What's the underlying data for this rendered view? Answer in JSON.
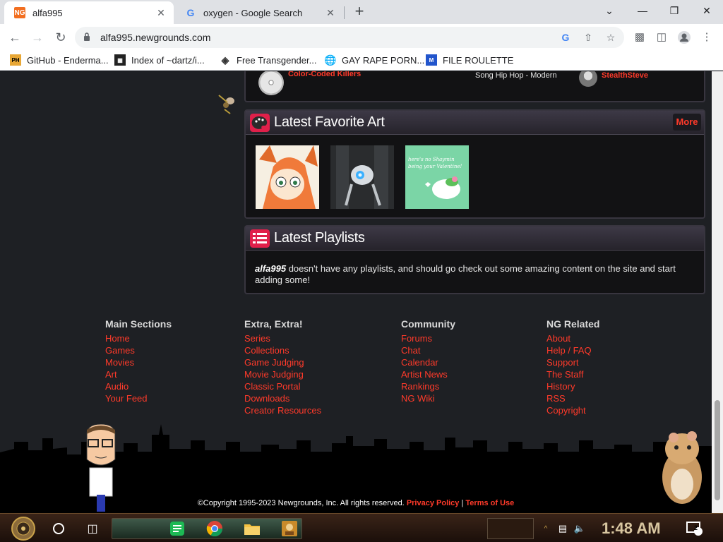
{
  "browser": {
    "tabs": [
      {
        "title": "alfa995",
        "favicon": "NG",
        "active": true
      },
      {
        "title": "oxygen - Google Search",
        "favicon": "G",
        "active": false
      }
    ],
    "new_tab": "+",
    "address": "alfa995.newgrounds.com",
    "window_controls": {
      "minimize": "—",
      "restore": "❐",
      "close": "✕",
      "tab_list": "⌄"
    }
  },
  "bookmarks": [
    {
      "label": "GitHub - Enderma...",
      "icon": "PH"
    },
    {
      "label": "Index of ~dartz/i...",
      "icon": "grid-icon"
    },
    {
      "label": "Free Transgender...",
      "icon": "hat-icon"
    },
    {
      "label": "GAY RAPE PORN...",
      "icon": "globe-icon"
    },
    {
      "label": "FILE ROULETTE",
      "icon": "M"
    }
  ],
  "audio_row": {
    "title": "Color-Coded Killers",
    "genre": "Song Hip Hop - Modern",
    "author": "StealthSteve"
  },
  "favorite_art": {
    "title": "Latest Favorite Art",
    "more": "More",
    "thumb3_text": "here's no Shaymin\nbeing your Valentine!"
  },
  "playlists": {
    "title": "Latest Playlists",
    "user": "alfa995",
    "message": " doesn't have any playlists, and should go check out some amazing content on the site and start adding some!"
  },
  "footer": {
    "columns": [
      {
        "heading": "Main Sections",
        "links": [
          "Home",
          "Games",
          "Movies",
          "Art",
          "Audio",
          "Your Feed"
        ]
      },
      {
        "heading": "Extra, Extra!",
        "links": [
          "Series",
          "Collections",
          "Game Judging",
          "Movie Judging",
          "Classic Portal",
          "Downloads",
          "Creator Resources"
        ]
      },
      {
        "heading": "Community",
        "links": [
          "Forums",
          "Chat",
          "Calendar",
          "Artist News",
          "Rankings",
          "NG Wiki"
        ]
      },
      {
        "heading": "NG Related",
        "links": [
          "About",
          "Help / FAQ",
          "Support",
          "The Staff",
          "History",
          "RSS",
          "Copyright"
        ]
      }
    ],
    "copyright": "©Copyright 1995-2023 Newgrounds, Inc. All rights reserved.",
    "privacy": "Privacy Policy",
    "separator": "|",
    "terms": "Terms of Use"
  },
  "taskbar": {
    "clock": "1:48 AM",
    "notification_count": "2"
  }
}
